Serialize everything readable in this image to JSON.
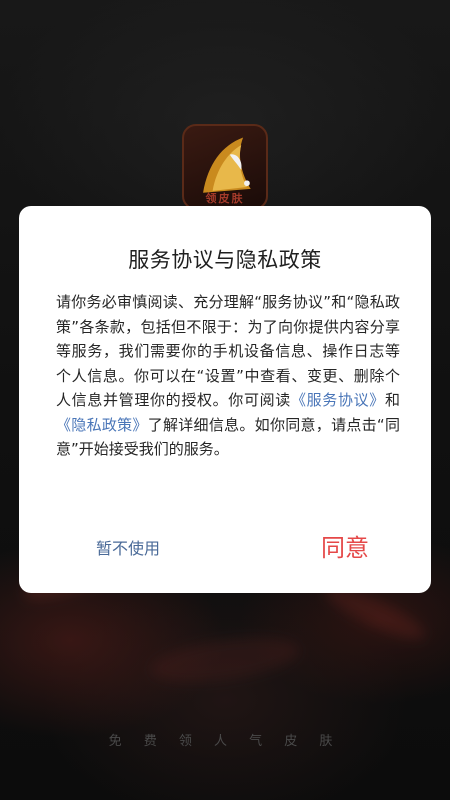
{
  "app": {
    "logo_text": "领皮肤",
    "tagline": "免 费 领 人 气 皮 肤"
  },
  "dialog": {
    "title": "服务协议与隐私政策",
    "body_before": "请你务必审慎阅读、充分理解“服务协议”和“隐私政策”各条款，包括但不限于：为了向你提供内容分享等服务，我们需要你的手机设备信息、操作日志等个人信息。你可以在“设置”中查看、变更、删除个人信息并管理你的授权。你可阅读",
    "link_service": "《服务协议》",
    "body_and": "和",
    "link_privacy": "《隐私政策》",
    "body_after": "了解详细信息。如你同意，请点击“同意”开始接受我们的服务。",
    "decline_label": "暂不使用",
    "agree_label": "同意"
  },
  "colors": {
    "agree": "#e54848",
    "decline": "#4a6a98",
    "link": "#4a76b8"
  }
}
